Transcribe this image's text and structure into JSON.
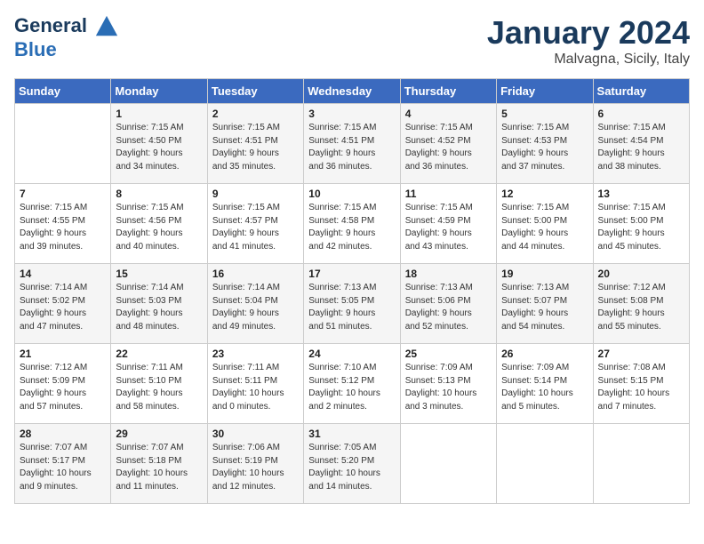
{
  "header": {
    "logo_line1": "General",
    "logo_line2": "Blue",
    "month": "January 2024",
    "location": "Malvagna, Sicily, Italy"
  },
  "days_of_week": [
    "Sunday",
    "Monday",
    "Tuesday",
    "Wednesday",
    "Thursday",
    "Friday",
    "Saturday"
  ],
  "weeks": [
    [
      {
        "num": "",
        "info": ""
      },
      {
        "num": "1",
        "info": "Sunrise: 7:15 AM\nSunset: 4:50 PM\nDaylight: 9 hours\nand 34 minutes."
      },
      {
        "num": "2",
        "info": "Sunrise: 7:15 AM\nSunset: 4:51 PM\nDaylight: 9 hours\nand 35 minutes."
      },
      {
        "num": "3",
        "info": "Sunrise: 7:15 AM\nSunset: 4:51 PM\nDaylight: 9 hours\nand 36 minutes."
      },
      {
        "num": "4",
        "info": "Sunrise: 7:15 AM\nSunset: 4:52 PM\nDaylight: 9 hours\nand 36 minutes."
      },
      {
        "num": "5",
        "info": "Sunrise: 7:15 AM\nSunset: 4:53 PM\nDaylight: 9 hours\nand 37 minutes."
      },
      {
        "num": "6",
        "info": "Sunrise: 7:15 AM\nSunset: 4:54 PM\nDaylight: 9 hours\nand 38 minutes."
      }
    ],
    [
      {
        "num": "7",
        "info": "Sunrise: 7:15 AM\nSunset: 4:55 PM\nDaylight: 9 hours\nand 39 minutes."
      },
      {
        "num": "8",
        "info": "Sunrise: 7:15 AM\nSunset: 4:56 PM\nDaylight: 9 hours\nand 40 minutes."
      },
      {
        "num": "9",
        "info": "Sunrise: 7:15 AM\nSunset: 4:57 PM\nDaylight: 9 hours\nand 41 minutes."
      },
      {
        "num": "10",
        "info": "Sunrise: 7:15 AM\nSunset: 4:58 PM\nDaylight: 9 hours\nand 42 minutes."
      },
      {
        "num": "11",
        "info": "Sunrise: 7:15 AM\nSunset: 4:59 PM\nDaylight: 9 hours\nand 43 minutes."
      },
      {
        "num": "12",
        "info": "Sunrise: 7:15 AM\nSunset: 5:00 PM\nDaylight: 9 hours\nand 44 minutes."
      },
      {
        "num": "13",
        "info": "Sunrise: 7:15 AM\nSunset: 5:00 PM\nDaylight: 9 hours\nand 45 minutes."
      }
    ],
    [
      {
        "num": "14",
        "info": "Sunrise: 7:14 AM\nSunset: 5:02 PM\nDaylight: 9 hours\nand 47 minutes."
      },
      {
        "num": "15",
        "info": "Sunrise: 7:14 AM\nSunset: 5:03 PM\nDaylight: 9 hours\nand 48 minutes."
      },
      {
        "num": "16",
        "info": "Sunrise: 7:14 AM\nSunset: 5:04 PM\nDaylight: 9 hours\nand 49 minutes."
      },
      {
        "num": "17",
        "info": "Sunrise: 7:13 AM\nSunset: 5:05 PM\nDaylight: 9 hours\nand 51 minutes."
      },
      {
        "num": "18",
        "info": "Sunrise: 7:13 AM\nSunset: 5:06 PM\nDaylight: 9 hours\nand 52 minutes."
      },
      {
        "num": "19",
        "info": "Sunrise: 7:13 AM\nSunset: 5:07 PM\nDaylight: 9 hours\nand 54 minutes."
      },
      {
        "num": "20",
        "info": "Sunrise: 7:12 AM\nSunset: 5:08 PM\nDaylight: 9 hours\nand 55 minutes."
      }
    ],
    [
      {
        "num": "21",
        "info": "Sunrise: 7:12 AM\nSunset: 5:09 PM\nDaylight: 9 hours\nand 57 minutes."
      },
      {
        "num": "22",
        "info": "Sunrise: 7:11 AM\nSunset: 5:10 PM\nDaylight: 9 hours\nand 58 minutes."
      },
      {
        "num": "23",
        "info": "Sunrise: 7:11 AM\nSunset: 5:11 PM\nDaylight: 10 hours\nand 0 minutes."
      },
      {
        "num": "24",
        "info": "Sunrise: 7:10 AM\nSunset: 5:12 PM\nDaylight: 10 hours\nand 2 minutes."
      },
      {
        "num": "25",
        "info": "Sunrise: 7:09 AM\nSunset: 5:13 PM\nDaylight: 10 hours\nand 3 minutes."
      },
      {
        "num": "26",
        "info": "Sunrise: 7:09 AM\nSunset: 5:14 PM\nDaylight: 10 hours\nand 5 minutes."
      },
      {
        "num": "27",
        "info": "Sunrise: 7:08 AM\nSunset: 5:15 PM\nDaylight: 10 hours\nand 7 minutes."
      }
    ],
    [
      {
        "num": "28",
        "info": "Sunrise: 7:07 AM\nSunset: 5:17 PM\nDaylight: 10 hours\nand 9 minutes."
      },
      {
        "num": "29",
        "info": "Sunrise: 7:07 AM\nSunset: 5:18 PM\nDaylight: 10 hours\nand 11 minutes."
      },
      {
        "num": "30",
        "info": "Sunrise: 7:06 AM\nSunset: 5:19 PM\nDaylight: 10 hours\nand 12 minutes."
      },
      {
        "num": "31",
        "info": "Sunrise: 7:05 AM\nSunset: 5:20 PM\nDaylight: 10 hours\nand 14 minutes."
      },
      {
        "num": "",
        "info": ""
      },
      {
        "num": "",
        "info": ""
      },
      {
        "num": "",
        "info": ""
      }
    ]
  ]
}
